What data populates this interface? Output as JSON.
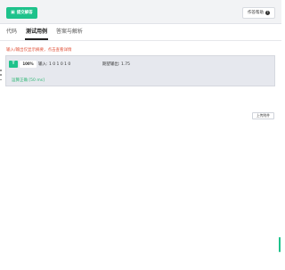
{
  "toolbar": {
    "submit_label": "提交解答",
    "submit_icon": "upload-icon",
    "help_label": "作答帮助",
    "help_icon": "question-circle-icon"
  },
  "tabs": [
    {
      "label": "代码",
      "active": false
    },
    {
      "label": "测试用例",
      "active": true
    },
    {
      "label": "答案与解析",
      "active": false
    }
  ],
  "warning": "输入/输出仅显示摘要，点击查看详情",
  "testcase": {
    "status_badge": "T",
    "pass_rate": "100%",
    "input": "输入: 1 0 1 0 1 0",
    "expected": "期望输出: 1.75",
    "result": "运算正确 [50 ms]"
  },
  "upload_label": "上传附件",
  "colors": {
    "accent": "#1ec28b",
    "warning": "#e0533a",
    "success": "#2bb673",
    "panel_bg": "#e6e8ee"
  }
}
